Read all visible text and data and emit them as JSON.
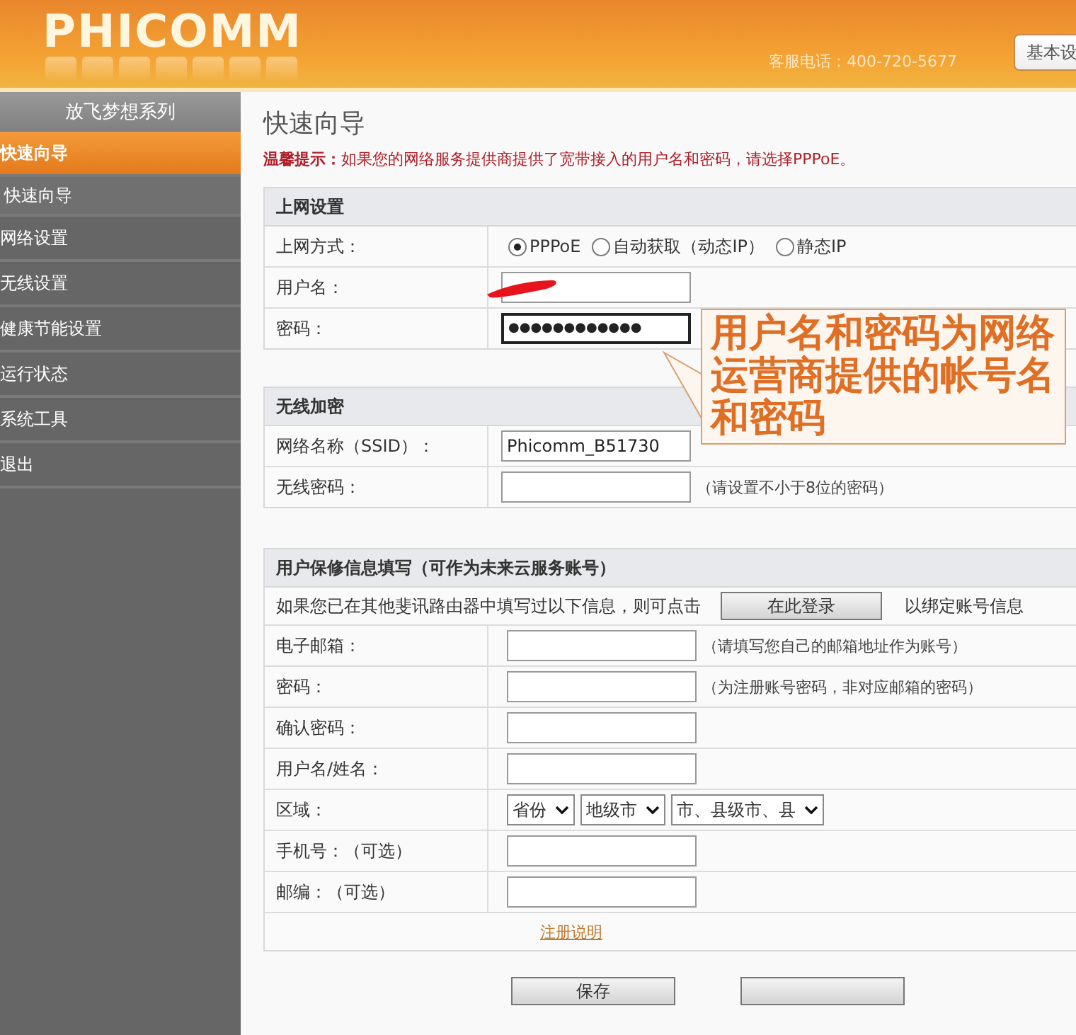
{
  "header": {
    "logo": "PHICOMM",
    "hotline": "客服电话：400-720-5677",
    "top_button": "基本设"
  },
  "sidebar": {
    "title": "放飞梦想系列",
    "items": [
      {
        "label": "快速向导",
        "selected": true,
        "children": [
          {
            "label": "快速向导",
            "selected": false
          }
        ]
      },
      {
        "label": "网络设置",
        "selected": false
      },
      {
        "label": "无线设置",
        "selected": false
      },
      {
        "label": "健康节能设置",
        "selected": false
      },
      {
        "label": "运行状态",
        "selected": false
      },
      {
        "label": "系统工具",
        "selected": false
      },
      {
        "label": "退出",
        "selected": false
      }
    ]
  },
  "page_title": "快速向导",
  "tip": "**温馨提示：**如果您的网络服务提供商提供了宽带接入的用户名和密码，请选择PPPoE。",
  "sections": [
    {
      "title": "上网设置",
      "rows": [
        {
          "kind": "radio",
          "label": "上网方式：",
          "options": [
            {
              "label": "PPPoE",
              "selected": true
            },
            {
              "label": "自动获取（动态IP）",
              "selected": false
            },
            {
              "label": "静态IP",
              "selected": false
            }
          ]
        },
        {
          "kind": "input",
          "label": "用户名：",
          "redacted": true
        },
        {
          "kind": "input",
          "label": "密码：",
          "value": "●●●●●●●●●●●●",
          "focused": true
        }
      ]
    },
    {
      "title": "无线加密",
      "rows": [
        {
          "kind": "input",
          "label": "网络名称（SSID）：",
          "value": "Phicomm_B51730"
        },
        {
          "kind": "input",
          "label": "无线密码：",
          "note": "（请设置不小于8位的密码）"
        }
      ]
    },
    {
      "title": "用户保修信息填写（可作为未来云服务账号）",
      "rows": [
        {
          "kind": "login",
          "text": "如果您已在其他斐讯路由器中填写过以下信息，则可点击",
          "button": "在此登录",
          "after": "以绑定账号信息"
        },
        {
          "kind": "input",
          "label": "电子邮箱：",
          "note": "（请填写您自己的邮箱地址作为账号）"
        },
        {
          "kind": "input",
          "label": "密码：",
          "note": "（为注册账号密码，非对应邮箱的密码）"
        },
        {
          "kind": "input",
          "label": "确认密码："
        },
        {
          "kind": "input",
          "label": "用户名/姓名："
        },
        {
          "kind": "selects",
          "label": "区域：",
          "options": [
            "省份",
            "地级市",
            "市、县级市、县"
          ]
        },
        {
          "kind": "input",
          "label": "手机号：（可选）"
        },
        {
          "kind": "input",
          "label": "邮编：（可选）"
        },
        {
          "kind": "link",
          "text": "注册说明"
        }
      ]
    }
  ],
  "callout": "用户名和密码为网络运营商提供的帐号名和密码",
  "buttons": [
    {
      "kind": "labeled",
      "label": "保存"
    },
    {
      "kind": "blank"
    }
  ]
}
